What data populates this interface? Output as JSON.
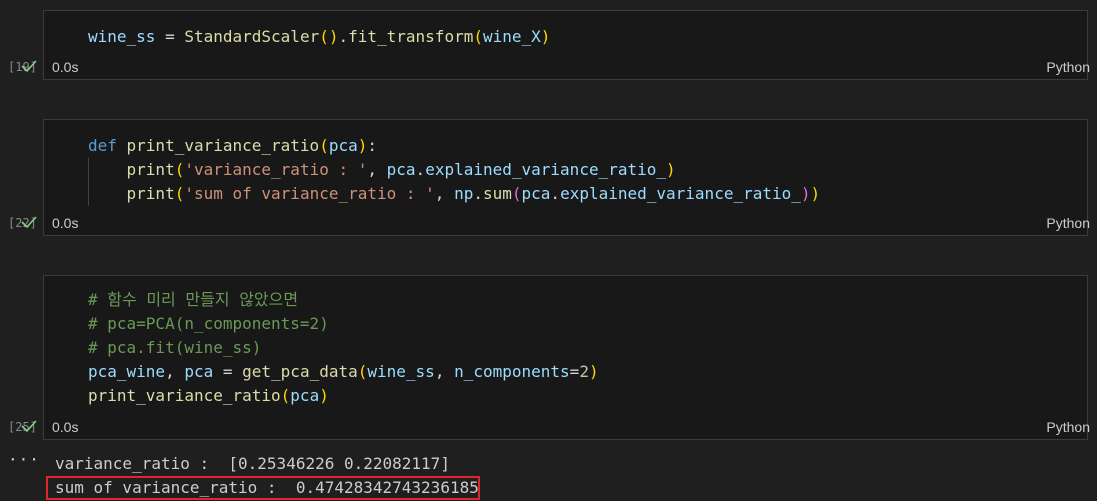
{
  "cells": [
    {
      "exec_count": "[19]",
      "status": "0.0s",
      "language": "Python",
      "lines": [
        [
          [
            "var",
            "wine_ss"
          ],
          [
            "op",
            " = "
          ],
          [
            "fn",
            "StandardScaler"
          ],
          [
            "p1",
            "()"
          ],
          [
            "op",
            "."
          ],
          [
            "fn",
            "fit_transform"
          ],
          [
            "p1",
            "("
          ],
          [
            "var",
            "wine_X"
          ],
          [
            "p1",
            ")"
          ]
        ]
      ]
    },
    {
      "exec_count": "[22]",
      "status": "0.0s",
      "language": "Python",
      "lines": [
        [
          [
            "kw",
            "def "
          ],
          [
            "fn",
            "print_variance_ratio"
          ],
          [
            "p1",
            "("
          ],
          [
            "var",
            "pca"
          ],
          [
            "p1",
            ")"
          ],
          [
            "op",
            ":"
          ]
        ],
        [
          [
            "op",
            "    "
          ],
          [
            "fn",
            "print"
          ],
          [
            "p1",
            "("
          ],
          [
            "str",
            "'variance_ratio : '"
          ],
          [
            "op",
            ", "
          ],
          [
            "var",
            "pca"
          ],
          [
            "op",
            "."
          ],
          [
            "var",
            "explained_variance_ratio_"
          ],
          [
            "p1",
            ")"
          ]
        ],
        [
          [
            "op",
            "    "
          ],
          [
            "fn",
            "print"
          ],
          [
            "p1",
            "("
          ],
          [
            "str",
            "'sum of variance_ratio : '"
          ],
          [
            "op",
            ", "
          ],
          [
            "var",
            "np"
          ],
          [
            "op",
            "."
          ],
          [
            "fn",
            "sum"
          ],
          [
            "p2",
            "("
          ],
          [
            "var",
            "pca"
          ],
          [
            "op",
            "."
          ],
          [
            "var",
            "explained_variance_ratio_"
          ],
          [
            "p2",
            ")"
          ],
          [
            "p1",
            ")"
          ]
        ]
      ]
    },
    {
      "exec_count": "[25]",
      "status": "0.0s",
      "language": "Python",
      "lines": [
        [
          [
            "cmt",
            "# 함수 미리 만들지 않았으면"
          ]
        ],
        [
          [
            "cmt",
            "# pca=PCA(n_components=2)"
          ]
        ],
        [
          [
            "cmt",
            "# pca.fit(wine_ss)"
          ]
        ],
        [
          [
            "var",
            "pca_wine"
          ],
          [
            "op",
            ", "
          ],
          [
            "var",
            "pca"
          ],
          [
            "op",
            " = "
          ],
          [
            "fn",
            "get_pca_data"
          ],
          [
            "p1",
            "("
          ],
          [
            "var",
            "wine_ss"
          ],
          [
            "op",
            ", "
          ],
          [
            "var",
            "n_components"
          ],
          [
            "op",
            "="
          ],
          [
            "num",
            "2"
          ],
          [
            "p1",
            ")"
          ]
        ],
        [
          [
            "fn",
            "print_variance_ratio"
          ],
          [
            "p1",
            "("
          ],
          [
            "var",
            "pca"
          ],
          [
            "p1",
            ")"
          ]
        ]
      ]
    }
  ],
  "output": {
    "more": "···",
    "line1": "variance_ratio :  [0.25346226 0.22082117]",
    "line2": "sum of variance_ratio :  0.47428342743236185"
  },
  "colors": {
    "highlight_border": "#e0252d",
    "check": "#89d185"
  }
}
